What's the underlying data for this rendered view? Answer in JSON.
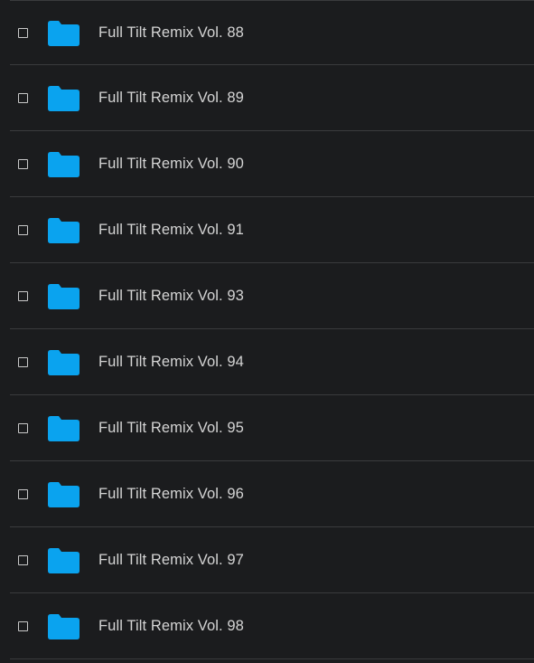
{
  "colors": {
    "background": "#1b1c1e",
    "divider": "#3a3b3d",
    "folder": "#0aa3ef",
    "text": "#d4d4d4",
    "checkbox": "#c9c9c9"
  },
  "folders": [
    {
      "name": "Full Tilt Remix Vol. 88",
      "icon": "folder-icon",
      "checked": false
    },
    {
      "name": "Full Tilt Remix Vol. 89",
      "icon": "folder-icon",
      "checked": false
    },
    {
      "name": "Full Tilt Remix Vol. 90",
      "icon": "folder-icon",
      "checked": false
    },
    {
      "name": "Full Tilt Remix Vol. 91",
      "icon": "folder-icon",
      "checked": false
    },
    {
      "name": "Full Tilt Remix Vol. 93",
      "icon": "folder-icon",
      "checked": false
    },
    {
      "name": "Full Tilt Remix Vol. 94",
      "icon": "folder-icon",
      "checked": false
    },
    {
      "name": "Full Tilt Remix Vol. 95",
      "icon": "folder-icon",
      "checked": false
    },
    {
      "name": "Full Tilt Remix Vol. 96",
      "icon": "folder-icon",
      "checked": false
    },
    {
      "name": "Full Tilt Remix Vol. 97",
      "icon": "folder-icon",
      "checked": false
    },
    {
      "name": "Full Tilt Remix Vol. 98",
      "icon": "folder-icon",
      "checked": false
    }
  ]
}
